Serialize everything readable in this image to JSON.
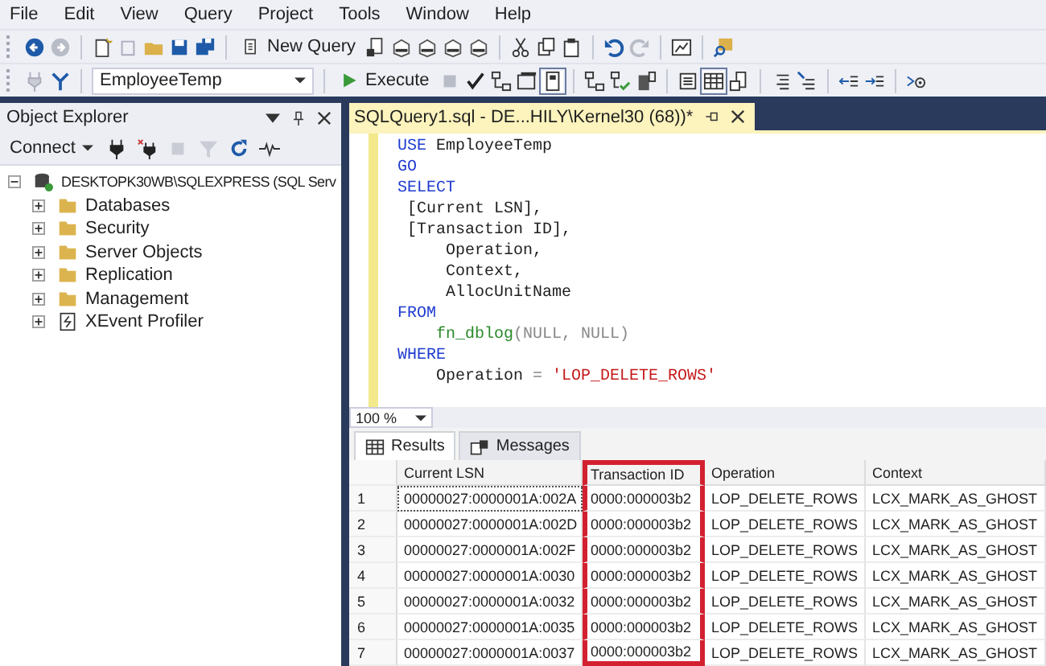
{
  "menu": [
    "File",
    "Edit",
    "View",
    "Query",
    "Project",
    "Tools",
    "Window",
    "Help"
  ],
  "toolbar": {
    "new_query": "New Query",
    "database": "EmployeeTemp",
    "execute": "Execute"
  },
  "object_explorer": {
    "title": "Object Explorer",
    "connect": "Connect",
    "tree": [
      {
        "label": "DESKTOPK30WB\\SQLEXPRESS (SQL Serv",
        "kind": "server",
        "expanded": true,
        "children": [
          {
            "label": "Databases",
            "kind": "folder",
            "expanded": false
          },
          {
            "label": "Security",
            "kind": "folder",
            "expanded": false
          },
          {
            "label": "Server Objects",
            "kind": "folder",
            "expanded": false
          },
          {
            "label": "Replication",
            "kind": "folder",
            "expanded": false
          },
          {
            "label": "Management",
            "kind": "folder",
            "expanded": false
          },
          {
            "label": "XEvent Profiler",
            "kind": "profiler",
            "expanded": false
          }
        ]
      }
    ]
  },
  "editor": {
    "tab": "SQLQuery1.sql - DE...HILY\\Kernel30 (68))*",
    "zoom": "100 %",
    "lines": [
      [
        {
          "kind": "keyword",
          "text": "USE"
        },
        {
          "kind": "plain",
          "text": " EmployeeTemp"
        }
      ],
      [
        {
          "kind": "keyword",
          "text": "GO"
        }
      ],
      [
        {
          "kind": "keyword",
          "text": "SELECT"
        }
      ],
      [
        {
          "kind": "plain",
          "text": " [Current LSN],"
        }
      ],
      [
        {
          "kind": "plain",
          "text": " [Transaction ID],"
        }
      ],
      [
        {
          "kind": "plain",
          "text": "     Operation,"
        }
      ],
      [
        {
          "kind": "plain",
          "text": "     Context,"
        }
      ],
      [
        {
          "kind": "plain",
          "text": "     AllocUnitName"
        }
      ],
      [
        {
          "kind": "keyword",
          "text": "FROM"
        }
      ],
      [
        {
          "kind": "function",
          "text": "    fn_dblog"
        },
        {
          "kind": "gray",
          "text": "(NULL, NULL)"
        }
      ],
      [
        {
          "kind": "keyword",
          "text": "WHERE"
        }
      ],
      [
        {
          "kind": "plain",
          "text": "    Operation"
        },
        {
          "kind": "gray",
          "text": " = "
        },
        {
          "kind": "string",
          "text": "'LOP_DELETE_ROWS'"
        }
      ]
    ]
  },
  "results": {
    "tabs": [
      {
        "label": "Results",
        "selected": true
      },
      {
        "label": "Messages",
        "selected": false
      }
    ],
    "columns": [
      {
        "label": "Current LSN",
        "highlighted": false
      },
      {
        "label": "Transaction ID",
        "highlighted": true
      },
      {
        "label": "Operation",
        "highlighted": false
      },
      {
        "label": "Context",
        "highlighted": false
      }
    ],
    "rows": [
      {
        "num": "1",
        "cells": [
          "00000027:0000001A:002A",
          "0000:000003b2",
          "LOP_DELETE_ROWS",
          "LCX_MARK_AS_GHOST"
        ]
      },
      {
        "num": "2",
        "cells": [
          "00000027:0000001A:002D",
          "0000:000003b2",
          "LOP_DELETE_ROWS",
          "LCX_MARK_AS_GHOST"
        ]
      },
      {
        "num": "3",
        "cells": [
          "00000027:0000001A:002F",
          "0000:000003b2",
          "LOP_DELETE_ROWS",
          "LCX_MARK_AS_GHOST"
        ]
      },
      {
        "num": "4",
        "cells": [
          "00000027:0000001A:0030",
          "0000:000003b2",
          "LOP_DELETE_ROWS",
          "LCX_MARK_AS_GHOST"
        ]
      },
      {
        "num": "5",
        "cells": [
          "00000027:0000001A:0032",
          "0000:000003b2",
          "LOP_DELETE_ROWS",
          "LCX_MARK_AS_GHOST"
        ]
      },
      {
        "num": "6",
        "cells": [
          "00000027:0000001A:0035",
          "0000:000003b2",
          "LOP_DELETE_ROWS",
          "LCX_MARK_AS_GHOST"
        ]
      },
      {
        "num": "7",
        "cells": [
          "00000027:0000001A:0037",
          "0000:000003b2",
          "LOP_DELETE_ROWS",
          "LCX_MARK_AS_GHOST"
        ]
      }
    ]
  }
}
